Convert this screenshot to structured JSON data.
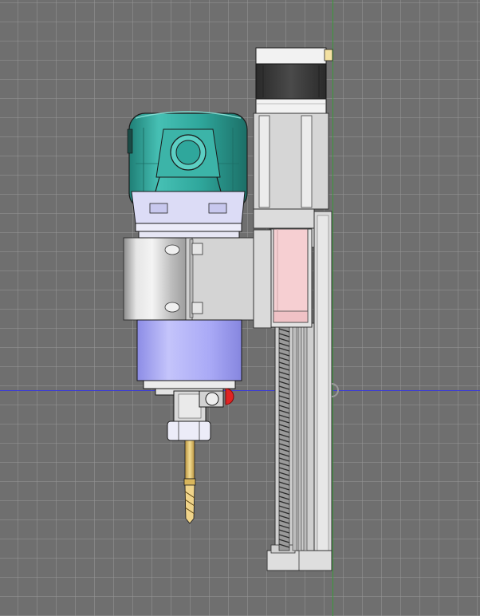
{
  "viewport": {
    "name": "cad-3d-viewport",
    "background": "#6f6f6f",
    "grid_color": "#8a8a8a",
    "x_axis_color": "#3a3ad8",
    "y_axis_color": "#3a9a3a"
  },
  "model": {
    "name": "cnc-spindle-z-axis-assembly",
    "colors": {
      "motor_housing_teal": "#2fa79c",
      "motor_cap_lavender": "#d8d8f4",
      "spindle_body_blue": "#a9a9f6",
      "mount_bracket_gray": "#d2d2d2",
      "carriage_pink": "#f6cfd2",
      "stepper_motor_dark": "#3d3d3d",
      "drill_bit_gold": "#e3c472",
      "button_red": "#e02424"
    }
  }
}
